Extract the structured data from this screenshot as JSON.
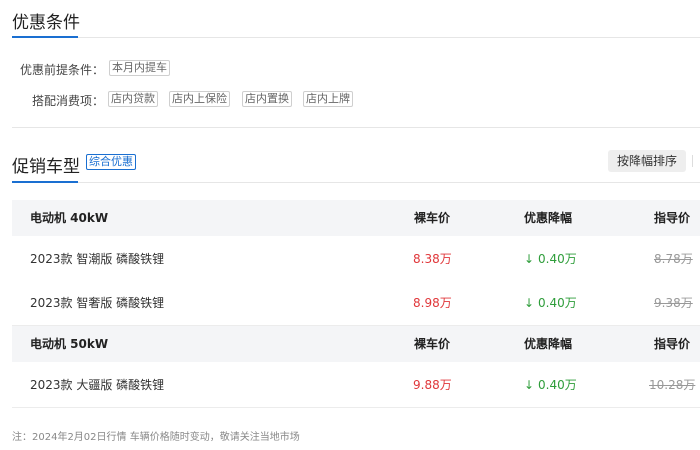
{
  "discount_section": {
    "title": "优惠条件",
    "precondition_label": "优惠前提条件：",
    "precondition_tags": [
      "本月内提车"
    ],
    "bundle_label": "搭配消费项：",
    "bundle_tags": [
      "店内贷款",
      "店内上保险",
      "店内置换",
      "店内上牌"
    ]
  },
  "promo_section": {
    "title": "促销车型",
    "badge": "综合优惠",
    "sort_button": "按降幅排序"
  },
  "table": {
    "columns": [
      "裸车价",
      "优惠降幅",
      "指导价"
    ],
    "groups": [
      {
        "name": "电动机 40kW",
        "rows": [
          {
            "model": "2023款 智潮版 磷酸铁锂",
            "price": "8.38万",
            "drop": "0.40万",
            "guide": "8.78万"
          },
          {
            "model": "2023款 智奢版 磷酸铁锂",
            "price": "8.98万",
            "drop": "0.40万",
            "guide": "9.38万"
          }
        ]
      },
      {
        "name": "电动机 50kW",
        "rows": [
          {
            "model": "2023款 大疆版 磷酸铁锂",
            "price": "9.88万",
            "drop": "0.40万",
            "guide": "10.28万"
          }
        ]
      }
    ]
  },
  "drop_arrow": "↓",
  "footnote": "注：2024年2月02日行情 车辆价格随时变动，敬请关注当地市场",
  "colors": {
    "accent": "#1a6fd1",
    "price": "#e0373a",
    "drop": "#2e9d3a",
    "guide": "#999999"
  }
}
